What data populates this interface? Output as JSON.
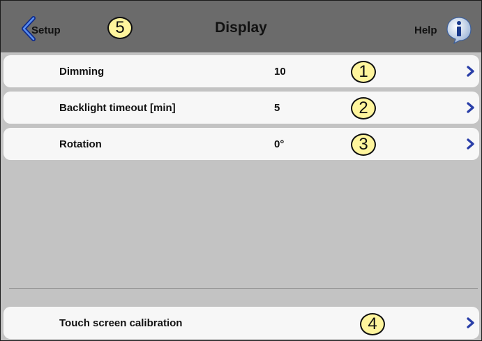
{
  "header": {
    "back_label": "Setup",
    "title": "Display",
    "help_label": "Help",
    "back_badge": "5"
  },
  "settings": [
    {
      "label": "Dimming",
      "value": "10",
      "badge": "1"
    },
    {
      "label": "Backlight timeout [min]",
      "value": "5",
      "badge": "2"
    },
    {
      "label": "Rotation",
      "value": "0°",
      "badge": "3"
    }
  ],
  "calibration": {
    "label": "Touch screen calibration",
    "badge": "4"
  },
  "icons": {
    "back": "chevron-left-icon",
    "help": "info-icon",
    "row": "chevron-right-icon"
  },
  "colors": {
    "header": "#6b6b6b",
    "background": "#c3c3c3",
    "row": "#f7f7f7",
    "accent": "#2a3fa8",
    "badge": "#fff59d"
  }
}
